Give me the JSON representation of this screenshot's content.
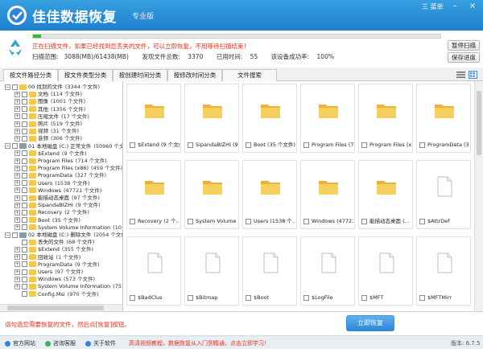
{
  "app": {
    "title": "佳佳数据恢复",
    "edition": "专业版",
    "menu_label": "三 菜单",
    "colors": {
      "titlebar": "#1f7fcf",
      "accent": "#2d86d6",
      "warning": "#e8301c",
      "folder": "#f2c94c",
      "progress": "#3ab53a"
    }
  },
  "scan": {
    "message": "正在扫描文件，如果已经找到您丢失的文件，可以立即恢复，不用等待扫描结束！",
    "progress_percent": 2,
    "range_label": "扫描范围:",
    "range_value": "3088(MB)/61438(MB)",
    "found_label": "发现文件总数:",
    "found_value": "3370",
    "time_label": "已用时间:",
    "time_value": "55",
    "perf_label": "该设备成功率:",
    "perf_value": "100%",
    "pause_button": "暂停扫描",
    "save_button": "保存进度"
  },
  "tabs": [
    {
      "label": "按文件路径分类",
      "active": true
    },
    {
      "label": "按文件类型分类",
      "active": false
    },
    {
      "label": "按创建时间分类",
      "active": false
    },
    {
      "label": "按修改时间分类",
      "active": false
    },
    {
      "label": "文件搜索",
      "active": false
    }
  ],
  "tree": [
    {
      "level": 0,
      "expander": "−",
      "kind": "folder",
      "label": "00 找到的文件",
      "count": "(3344 个文件)"
    },
    {
      "level": 1,
      "expander": "+",
      "kind": "folder",
      "label": "文档",
      "count": "(114 个文件)"
    },
    {
      "level": 1,
      "expander": "+",
      "kind": "folder",
      "label": "图像",
      "count": "(1001 个文件)"
    },
    {
      "level": 1,
      "expander": "+",
      "kind": "folder",
      "label": "其他",
      "count": "(1356 个文件)"
    },
    {
      "level": 1,
      "expander": "+",
      "kind": "folder",
      "label": "压缩文件",
      "count": "(17 个文件)"
    },
    {
      "level": 1,
      "expander": "+",
      "kind": "folder",
      "label": "照片",
      "count": "(519 个文件)"
    },
    {
      "level": 1,
      "expander": "+",
      "kind": "folder",
      "label": "视频",
      "count": "(31 个文件)"
    },
    {
      "level": 1,
      "expander": "+",
      "kind": "folder",
      "label": "音频",
      "count": "(306 个文件)"
    },
    {
      "level": 0,
      "expander": "−",
      "kind": "drive",
      "label": "01 本地磁盘 (C:) 正常文件",
      "count": "(50960 个文"
    },
    {
      "level": 1,
      "expander": "+",
      "kind": "folder",
      "label": "$Extend",
      "count": "(9 个文件)"
    },
    {
      "level": 1,
      "expander": "+",
      "kind": "folder",
      "label": "Program Files",
      "count": "(714 个文件)"
    },
    {
      "level": 1,
      "expander": "+",
      "kind": "folder",
      "label": "Program Files (x86)",
      "count": "(459 个文件)"
    },
    {
      "level": 1,
      "expander": "+",
      "kind": "folder",
      "label": "ProgramData",
      "count": "(327 个文件)"
    },
    {
      "level": 1,
      "expander": "+",
      "kind": "folder",
      "label": "Users",
      "count": "(1538 个文件)"
    },
    {
      "level": 1,
      "expander": "+",
      "kind": "folder",
      "label": "Windows",
      "count": "(47721 个文件)"
    },
    {
      "level": 1,
      "expander": "+",
      "kind": "folder",
      "label": "能描动态桌面",
      "count": "(97 个文件)"
    },
    {
      "level": 1,
      "expander": "+",
      "kind": "folder",
      "label": "SipandaBIZHI",
      "count": "(9 个文件)"
    },
    {
      "level": 1,
      "expander": "+",
      "kind": "folder",
      "label": "Recovery",
      "count": "(2 个文件)"
    },
    {
      "level": 1,
      "expander": "+",
      "kind": "folder",
      "label": "Boot",
      "count": "(35 个文件)"
    },
    {
      "level": 1,
      "expander": "+",
      "kind": "folder",
      "label": "System Volume Information",
      "count": "(10 个"
    },
    {
      "level": 0,
      "expander": "−",
      "kind": "drive",
      "label": "02 本地磁盘 (C:) 删除文件",
      "count": "(2054 个文件"
    },
    {
      "level": 1,
      "expander": "",
      "kind": "folder",
      "label": "丢失的文件",
      "count": "(68 个文件)"
    },
    {
      "level": 1,
      "expander": "+",
      "kind": "folder",
      "label": "$Extend",
      "count": "(355 个文件)"
    },
    {
      "level": 1,
      "expander": "+",
      "kind": "folder",
      "label": "回收站",
      "count": "(1 个文件)"
    },
    {
      "level": 1,
      "expander": "+",
      "kind": "folder",
      "label": "ProgramData",
      "count": "(9 个文件)"
    },
    {
      "level": 1,
      "expander": "+",
      "kind": "folder",
      "label": "Users",
      "count": "(97 个文件)"
    },
    {
      "level": 1,
      "expander": "+",
      "kind": "folder",
      "label": "Windows",
      "count": "(573 个文件)"
    },
    {
      "level": 1,
      "expander": "+",
      "kind": "folder",
      "label": "System Volume Information",
      "count": "(75 个"
    },
    {
      "level": 1,
      "expander": "",
      "kind": "folder",
      "label": "Config.Msi",
      "count": "(970 个文件)"
    }
  ],
  "grid": [
    {
      "kind": "folder",
      "caption": "$Extend (9 个文件)"
    },
    {
      "kind": "folder",
      "caption": "SipandaBIZHI (9 个文件)"
    },
    {
      "kind": "folder",
      "caption": "Boot (35 个文件)"
    },
    {
      "kind": "folder",
      "caption": "Program Files (71..."
    },
    {
      "kind": "folder",
      "caption": "Program Files (x8..."
    },
    {
      "kind": "folder",
      "caption": "ProgramData (32..."
    },
    {
      "kind": "folder",
      "caption": "Recovery (2 个..."
    },
    {
      "kind": "folder",
      "caption": "System Volume In..."
    },
    {
      "kind": "folder",
      "caption": "Users (1538 个..."
    },
    {
      "kind": "folder",
      "caption": "Windows (47721 ..."
    },
    {
      "kind": "folder",
      "caption": "能描动态桌面 (..."
    },
    {
      "kind": "file",
      "caption": "$AttrDef"
    },
    {
      "kind": "file",
      "caption": "$BadClus"
    },
    {
      "kind": "file",
      "caption": "$Bitmap"
    },
    {
      "kind": "file",
      "caption": "$Boot"
    },
    {
      "kind": "file",
      "caption": "$LogFile"
    },
    {
      "kind": "file",
      "caption": "$MFT"
    },
    {
      "kind": "file",
      "caption": "$MFTMirr"
    }
  ],
  "hint": "请勾选您需要恢复的文件，然后点[恢复]按钮。",
  "recover_button": "立即恢复",
  "footer": {
    "site": "官方网站",
    "consult": "咨询客服",
    "about": "关于软件",
    "promo": "高清视频教程，数据恢复从入门到精通，点击立即学习！",
    "version": "版本: 6.7.5"
  }
}
